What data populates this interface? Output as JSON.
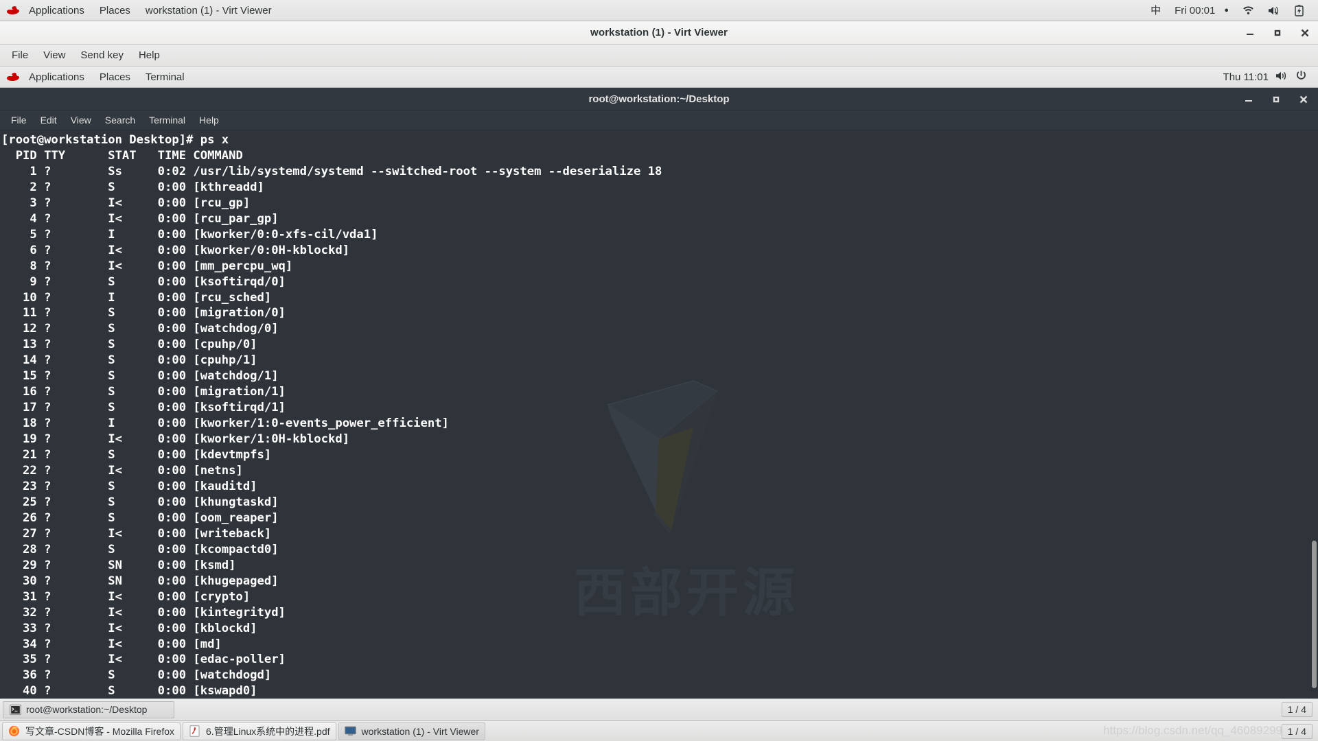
{
  "host_panel": {
    "logo_icon": "redhat-logo-icon",
    "menus": [
      "Applications",
      "Places"
    ],
    "window_title": "workstation (1) - Virt Viewer",
    "tray": {
      "input_method": "中",
      "clock": "Fri 00:01",
      "recording_dot": "●",
      "network_icon": "wifi-icon",
      "volume_icon": "volume-muted-icon",
      "battery_icon": "battery-charging-icon"
    }
  },
  "virt_viewer": {
    "title": "workstation (1) - Virt Viewer",
    "menus": [
      "File",
      "View",
      "Send key",
      "Help"
    ],
    "window_buttons": {
      "minimize": "minimize-icon",
      "maximize": "maximize-icon",
      "close": "close-icon"
    }
  },
  "guest_panel": {
    "logo_icon": "redhat-logo-icon",
    "menus": [
      "Applications",
      "Places",
      "Terminal"
    ],
    "tray": {
      "clock": "Thu 11:01",
      "volume_icon": "volume-icon",
      "power_icon": "power-icon"
    }
  },
  "terminal": {
    "title": "root@workstation:~/Desktop",
    "menus": [
      "File",
      "Edit",
      "View",
      "Search",
      "Terminal",
      "Help"
    ],
    "window_buttons": {
      "minimize": "minimize-icon",
      "maximize": "maximize-icon",
      "close": "close-icon"
    },
    "prompt_line": "[root@workstation Desktop]# ps x",
    "header_line": "  PID TTY      STAT   TIME COMMAND",
    "rows": [
      "    1 ?        Ss     0:02 /usr/lib/systemd/systemd --switched-root --system --deserialize 18",
      "    2 ?        S      0:00 [kthreadd]",
      "    3 ?        I<     0:00 [rcu_gp]",
      "    4 ?        I<     0:00 [rcu_par_gp]",
      "    5 ?        I      0:00 [kworker/0:0-xfs-cil/vda1]",
      "    6 ?        I<     0:00 [kworker/0:0H-kblockd]",
      "    8 ?        I<     0:00 [mm_percpu_wq]",
      "    9 ?        S      0:00 [ksoftirqd/0]",
      "   10 ?        I      0:00 [rcu_sched]",
      "   11 ?        S      0:00 [migration/0]",
      "   12 ?        S      0:00 [watchdog/0]",
      "   13 ?        S      0:00 [cpuhp/0]",
      "   14 ?        S      0:00 [cpuhp/1]",
      "   15 ?        S      0:00 [watchdog/1]",
      "   16 ?        S      0:00 [migration/1]",
      "   17 ?        S      0:00 [ksoftirqd/1]",
      "   18 ?        I      0:00 [kworker/1:0-events_power_efficient]",
      "   19 ?        I<     0:00 [kworker/1:0H-kblockd]",
      "   21 ?        S      0:00 [kdevtmpfs]",
      "   22 ?        I<     0:00 [netns]",
      "   23 ?        S      0:00 [kauditd]",
      "   25 ?        S      0:00 [khungtaskd]",
      "   26 ?        S      0:00 [oom_reaper]",
      "   27 ?        I<     0:00 [writeback]",
      "   28 ?        S      0:00 [kcompactd0]",
      "   29 ?        SN     0:00 [ksmd]",
      "   30 ?        SN     0:00 [khugepaged]",
      "   31 ?        I<     0:00 [crypto]",
      "   32 ?        I<     0:00 [kintegrityd]",
      "   33 ?        I<     0:00 [kblockd]",
      "   34 ?        I<     0:00 [md]",
      "   35 ?        I<     0:00 [edac-poller]",
      "   36 ?        S      0:00 [watchdogd]",
      "   40 ?        S      0:00 [kswapd0]"
    ],
    "watermark_text": "西部开源"
  },
  "guest_taskbar": {
    "task_label": "root@workstation:~/Desktop",
    "task_icon": "terminal-icon",
    "workspace": "1 / 4"
  },
  "host_taskbar": {
    "tasks": [
      {
        "label": "写文章-CSDN博客 - Mozilla Firefox",
        "icon": "firefox-icon",
        "active": false
      },
      {
        "label": "6.管理Linux系统中的进程.pdf",
        "icon": "pdf-icon",
        "active": false
      },
      {
        "label": "workstation (1) - Virt Viewer",
        "icon": "virt-viewer-icon",
        "active": true
      }
    ],
    "workspace": "1 / 4",
    "watermark_url": "https://blog.csdn.net/qq_46089299"
  },
  "colors": {
    "terminal_bg": "#2f343b",
    "terminal_fg": "#ffffff",
    "panel_bg": "#ececec",
    "accent_red": "#cc0000"
  }
}
